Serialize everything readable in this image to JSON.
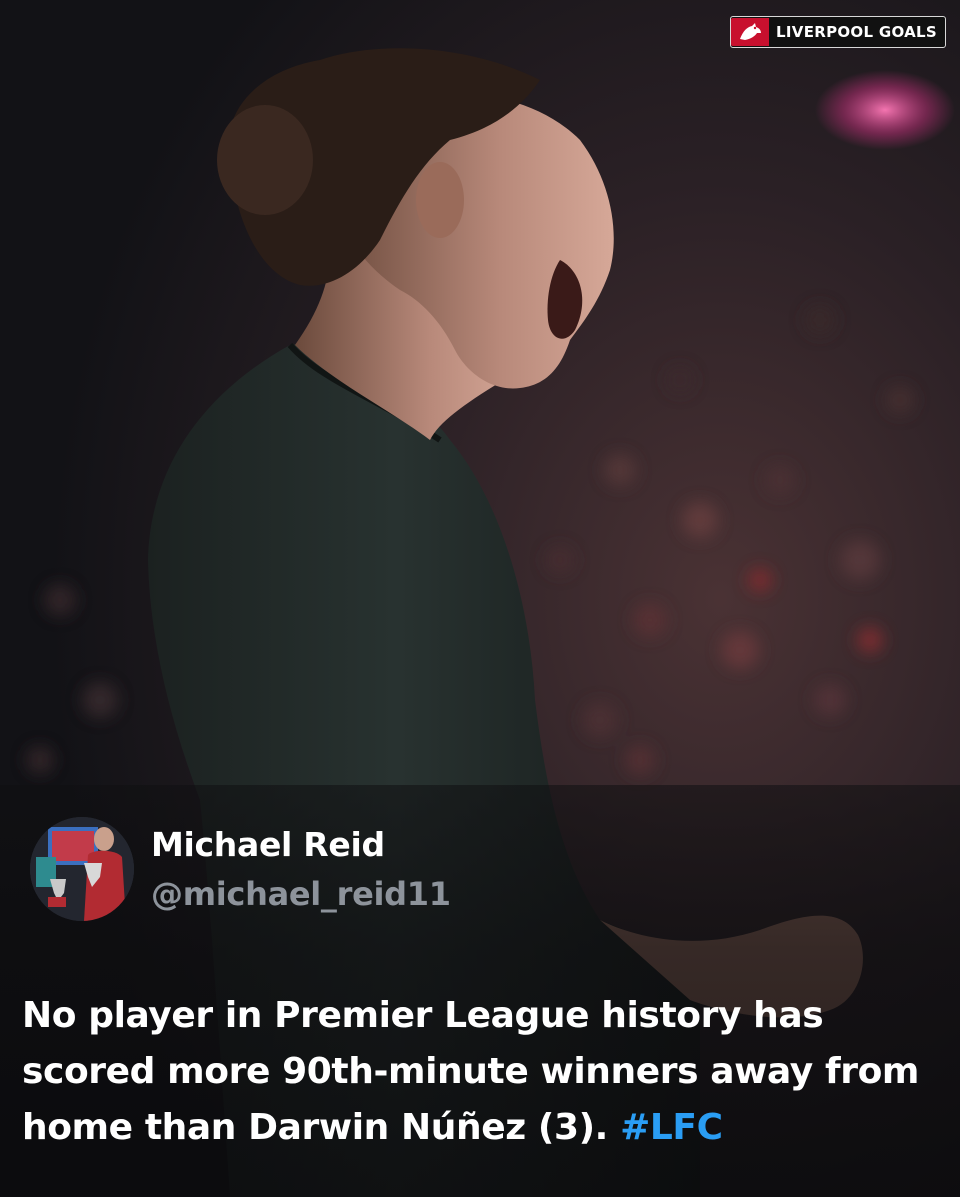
{
  "brand": {
    "label": "LIVERPOOL GOALS",
    "icon": "liverbird-icon",
    "accent": "#c8102e"
  },
  "tweet": {
    "author_name": "Michael Reid",
    "handle": "@michael_reid11",
    "text": "No player in Premier League history has scored more 90th-minute winners away from home than Darwin Núñez (3).",
    "hashtag": "#LFC",
    "hashtag_color": "#2a9df4"
  }
}
